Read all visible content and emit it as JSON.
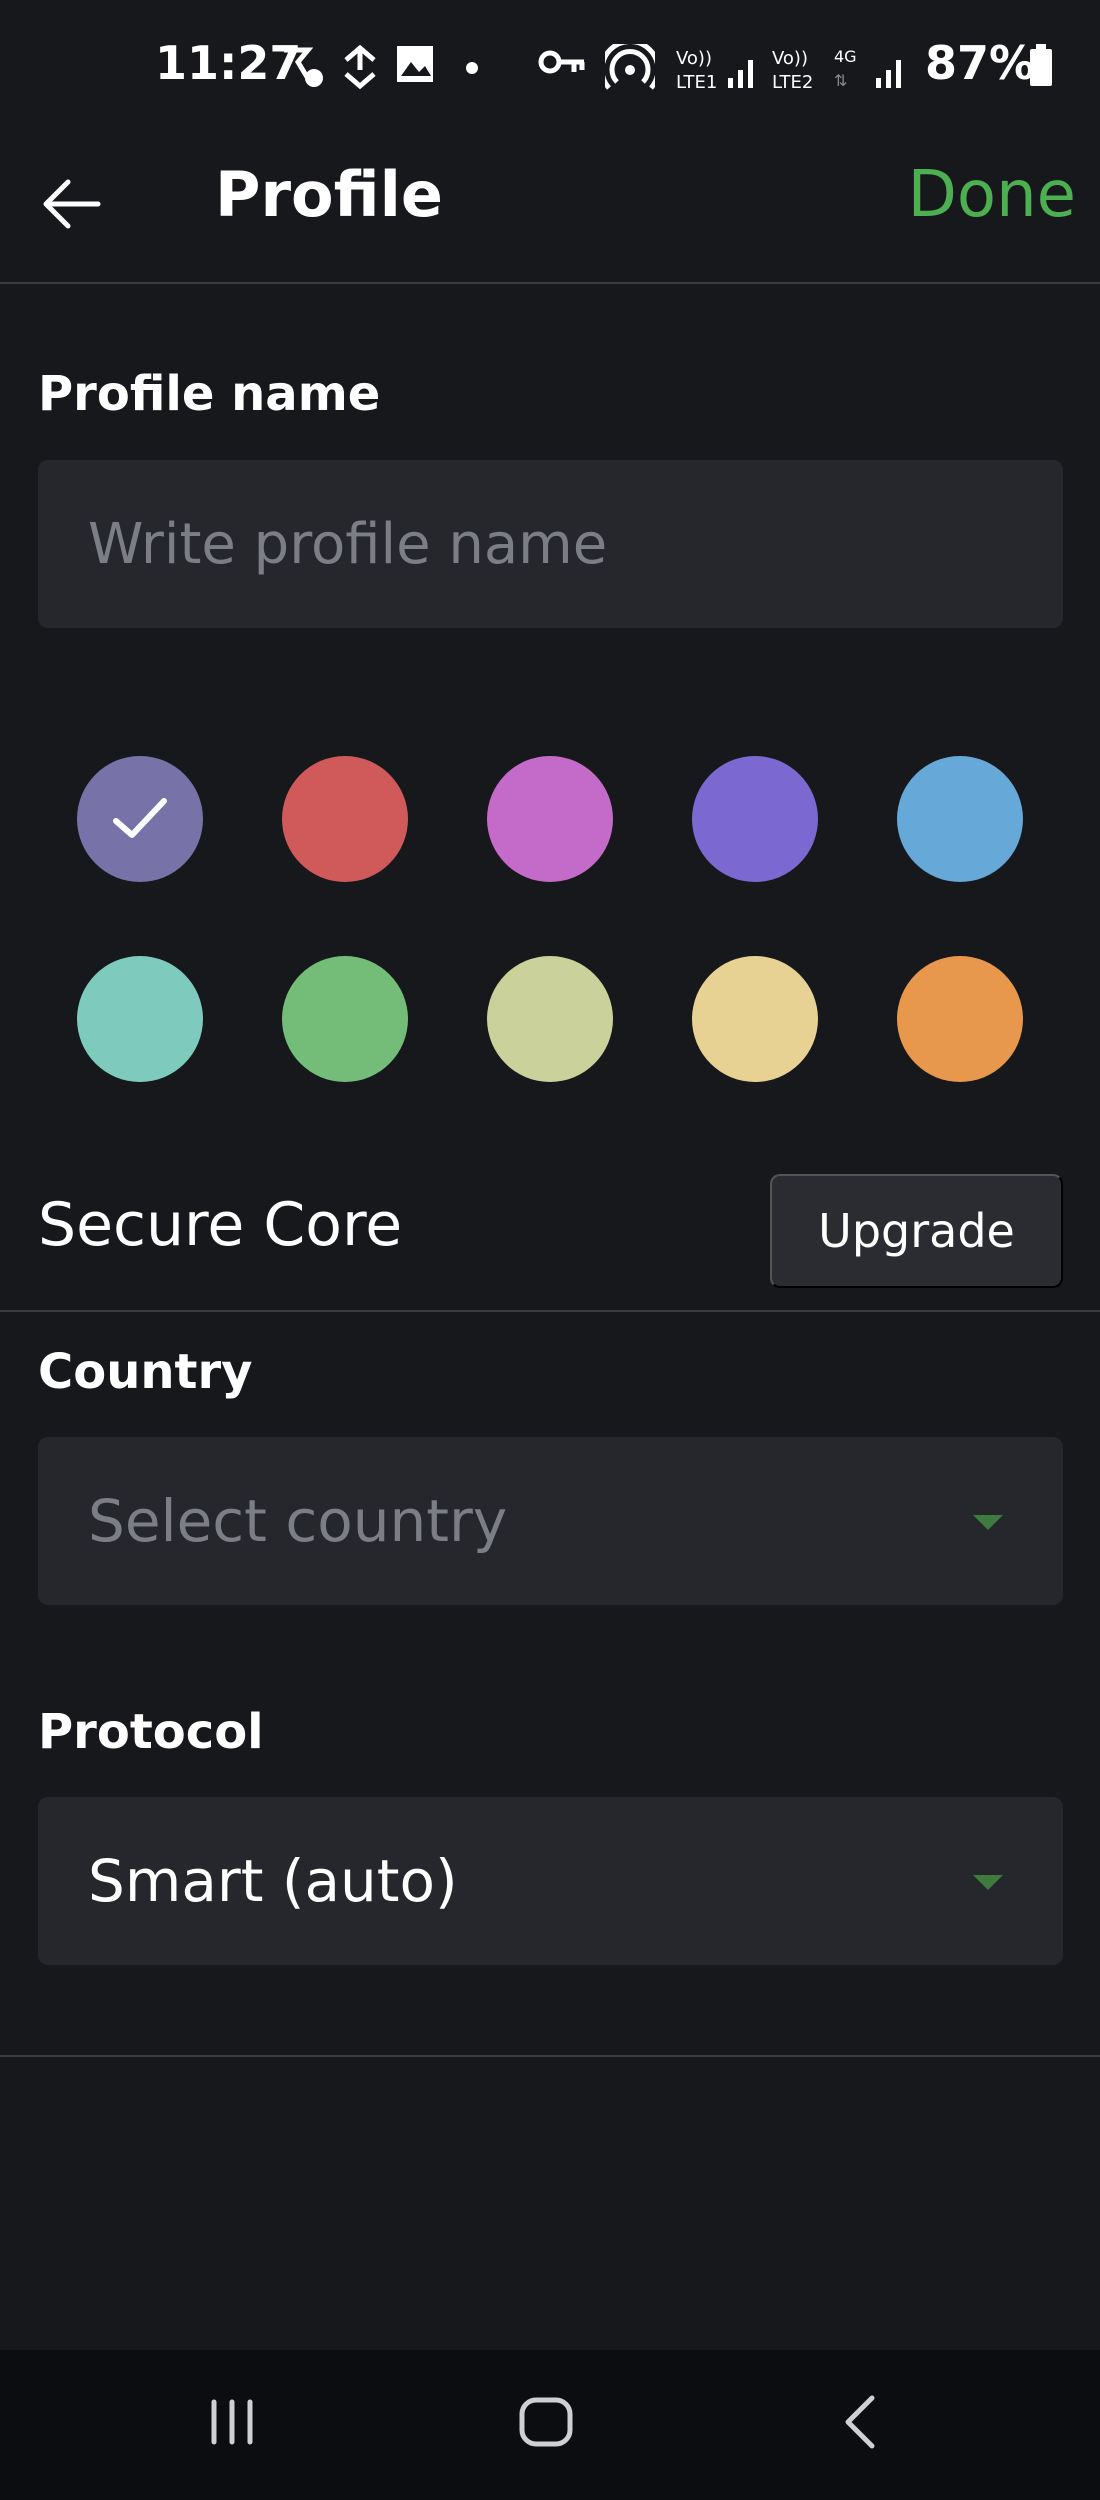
{
  "status_bar": {
    "time": "11:27",
    "battery_percent": "87%",
    "icons": [
      "call-forward-icon",
      "sync-icon",
      "image-icon",
      "dot-icon",
      "vpn-key-icon",
      "hotspot-icon",
      "volte1-signal-icon",
      "volte2-4g-signal-icon",
      "battery-icon"
    ]
  },
  "toolbar": {
    "back_icon": "arrow-left-icon",
    "title": "Profile",
    "done_label": "Done"
  },
  "profile_name": {
    "label": "Profile name",
    "value": "",
    "placeholder": "Write profile name"
  },
  "colors": {
    "selected_index": 0,
    "swatches": [
      "#7773a8",
      "#d05a5a",
      "#c46bc9",
      "#7b69d1",
      "#66a8d8",
      "#7ecbbd",
      "#73bd78",
      "#cbd19b",
      "#e8d293",
      "#e8984c"
    ]
  },
  "secure_core": {
    "label": "Secure Core",
    "upgrade_label": "Upgrade"
  },
  "country": {
    "label": "Country",
    "value": "",
    "placeholder": "Select country"
  },
  "protocol": {
    "label": "Protocol",
    "value": "Smart (auto)"
  },
  "accent_color": "#4caf50",
  "nav_bar": {
    "icons": [
      "recent-apps-icon",
      "home-icon",
      "back-icon"
    ]
  }
}
